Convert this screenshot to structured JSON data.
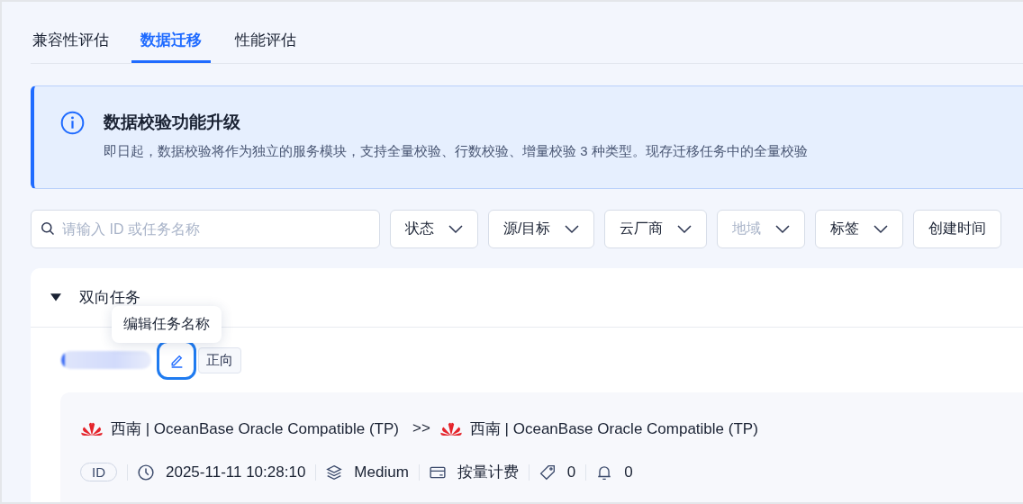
{
  "tabs": [
    {
      "label": "兼容性评估",
      "selected": false
    },
    {
      "label": "数据迁移",
      "selected": true
    },
    {
      "label": "性能评估",
      "selected": false
    }
  ],
  "notice": {
    "title": "数据校验功能升级",
    "text": "即日起，数据校验将作为独立的服务模块，支持全量校验、行数校验、增量校验 3 种类型。现存迁移任务中的全量校验"
  },
  "search": {
    "placeholder": "请输入 ID 或任务名称"
  },
  "filters": [
    {
      "label": "状态",
      "disabled": false
    },
    {
      "label": "源/目标",
      "disabled": false
    },
    {
      "label": "云厂商",
      "disabled": false
    },
    {
      "label": "地域",
      "disabled": true
    },
    {
      "label": "标签",
      "disabled": false
    },
    {
      "label": "创建时间",
      "disabled": false
    }
  ],
  "group": {
    "title": "双向任务",
    "expanded": true
  },
  "tooltip": "编辑任务名称",
  "task": {
    "direction_tag": "正向",
    "source": "西南 | OceanBase Oracle Compatible (TP)",
    "arrow": ">>",
    "target": "西南 | OceanBase Oracle Compatible (TP)",
    "id_badge": "ID",
    "created": "2025-11-11 10:28:10",
    "spec": "Medium",
    "billing": "按量计费",
    "tags": "0",
    "alerts": "0"
  }
}
